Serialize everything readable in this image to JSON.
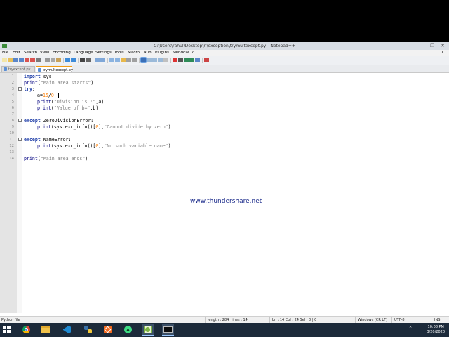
{
  "window": {
    "title": "C:\\Users\\rahul\\Desktop\\rj\\exception\\trymultexcept.py - Notepad++",
    "minimize": "–",
    "maximize": "❐",
    "close": "✕"
  },
  "menubar": {
    "items": [
      "File",
      "Edit",
      "Search",
      "View",
      "Encoding",
      "Language",
      "Settings",
      "Tools",
      "Macro",
      "Run",
      "Plugins",
      "Window",
      "?"
    ],
    "close_x": "X"
  },
  "tabs": [
    {
      "label": "tryexcept.py"
    },
    {
      "label": "trymultexcept.py"
    }
  ],
  "editor": {
    "line_numbers": [
      "1",
      "2",
      "3",
      "4",
      "5",
      "6",
      "7",
      "8",
      "9",
      "10",
      "11",
      "12",
      "13",
      "14"
    ],
    "lines": {
      "l1": {
        "kw": "import",
        "rest": " sys"
      },
      "l2": {
        "fn": "print",
        "open": "(",
        "str": "\"Main area starts\"",
        "close": ")"
      },
      "l3": {
        "kw": "try",
        "rest": ":"
      },
      "l4": {
        "pre": "a=",
        "num1": "15",
        "op": "/",
        "num2": "0"
      },
      "l5": {
        "fn": "print",
        "open": "(",
        "str": "\"Division is :\"",
        "close": ",a)"
      },
      "l6": {
        "fn": "print",
        "open": "(",
        "str": "\"Value of b=\"",
        "close": ",b)"
      },
      "l8": {
        "kw": "except",
        "rest": " ZeroDivisionError:"
      },
      "l9": {
        "fn": "print",
        "open": "(sys.exc_info()[",
        "num": "0",
        "mid": "],",
        "str": "\"Cannot divide by zero\"",
        "close": ")"
      },
      "l11": {
        "kw": "except",
        "rest": " NameError:"
      },
      "l12": {
        "fn": "print",
        "open": "(sys.exc_info()[",
        "num": "0",
        "mid": "],",
        "str": "\"No such variable name\"",
        "close": ")"
      },
      "l14": {
        "fn": "print",
        "open": "(",
        "str": "\"Main area ends\"",
        "close": ")"
      }
    }
  },
  "watermark": "www.thundershare.net",
  "statusbar": {
    "file_type": "Python file",
    "length": "length : 284",
    "lines": "lines : 14",
    "position": "Ln : 14   Col : 24   Sel : 0 | 0",
    "eol": "Windows (CR LF)",
    "encoding": "UTF-8",
    "mode": "INS"
  },
  "taskbar": {
    "time": "10:08 PM",
    "date": "3/20/2020"
  }
}
